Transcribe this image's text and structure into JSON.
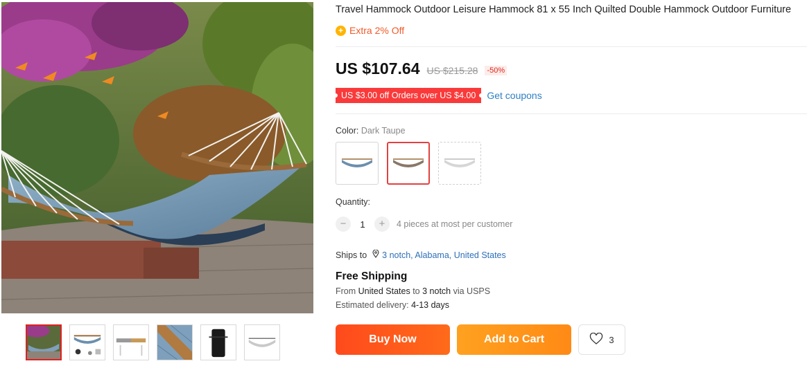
{
  "product": {
    "title": "Travel Hammock Outdoor Leisure Hammock 81 x 55 Inch Quilted Double Hammock Outdoor Furniture",
    "extra_icon": "plus-coin-icon",
    "extra_label": "Extra 2% Off",
    "price": "US $107.64",
    "old_price": "US $215.28",
    "discount": "-50%",
    "coupon_label": "US $3.00 off Orders over US $4.00",
    "get_coupons": "Get coupons"
  },
  "color": {
    "label": "Color:",
    "selected_value": "Dark Taupe",
    "swatches": [
      {
        "name": "blue",
        "fabric": "#6b8fae"
      },
      {
        "name": "dark-taupe",
        "fabric": "#8a7768"
      },
      {
        "name": "light-gray",
        "fabric": "#cfcfcf"
      }
    ],
    "selected_index": 1
  },
  "quantity": {
    "label": "Quantity:",
    "minus": "−",
    "value": "1",
    "plus": "+",
    "note": "4 pieces at most per customer"
  },
  "shipping": {
    "ships_label": "Ships to",
    "location_icon": "map-pin-icon",
    "location": "3 notch, Alabama, United States",
    "free_title": "Free Shipping",
    "from_prefix": "From",
    "from_country": "United States",
    "from_mid": "to",
    "from_dest": "3 notch",
    "from_via": "via USPS",
    "est_label": "Estimated delivery:",
    "est_value": "4-13 days"
  },
  "actions": {
    "buy_now": "Buy Now",
    "add_to_cart": "Add to Cart",
    "wish_icon": "heart-icon",
    "wish_count": "3"
  },
  "gallery": {
    "thumbnails": [
      "hammock-garden",
      "hammock-parts",
      "hammock-stand",
      "hammock-closeup",
      "carry-bag",
      "hammock-white"
    ],
    "active_index": 0
  },
  "colors": {
    "accent_red": "#e02020",
    "price_orange": "#f05a28",
    "buy_now": "#ff4a1c",
    "add_to_cart": "#ff9a1a",
    "link_blue": "#2d7fc4"
  }
}
